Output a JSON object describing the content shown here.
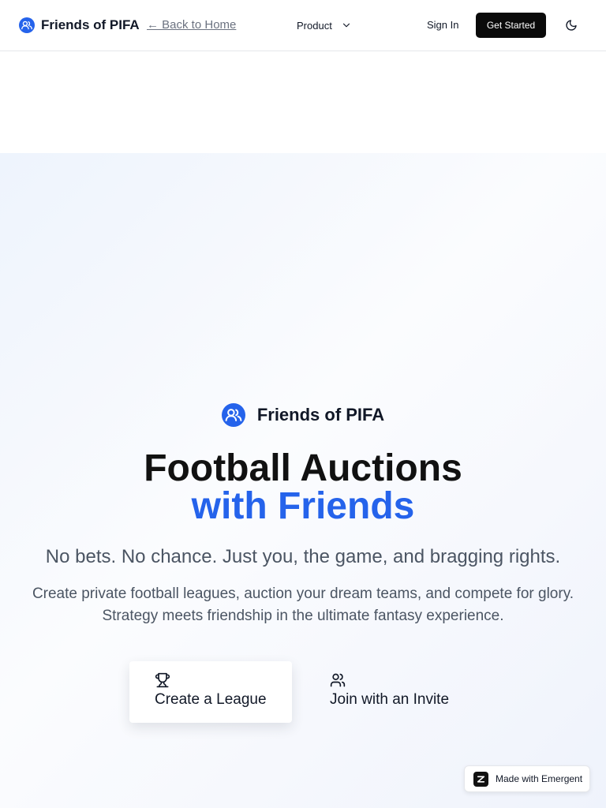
{
  "nav": {
    "brand_name": "Friends of PIFA",
    "back_link": "← Back to Home",
    "product_label": "Product",
    "signin_label": "Sign In",
    "get_started_label": "Get Started"
  },
  "hero": {
    "brand_name": "Friends of PIFA",
    "headline_line1": "Football Auctions",
    "headline_line2": "with Friends",
    "tagline": "No bets. No chance. Just you, the game, and bragging rights.",
    "description": "Create private football leagues, auction your dream teams, and compete for glory. Strategy meets friendship in the ultimate fantasy experience.",
    "create_league_label": "Create a League",
    "join_invite_label": "Join with an Invite"
  },
  "badge": {
    "label": "Made with Emergent"
  },
  "icons": {
    "brand": "users-circle-icon",
    "product_chevron": "chevron-down-icon",
    "theme": "moon-icon",
    "create": "trophy-icon",
    "join": "users-icon",
    "emergent": "emergent-logo-icon"
  },
  "colors": {
    "accent": "#2563eb",
    "primary_button": "#0a0a0a",
    "text": "#111827",
    "muted": "#4b5563"
  }
}
